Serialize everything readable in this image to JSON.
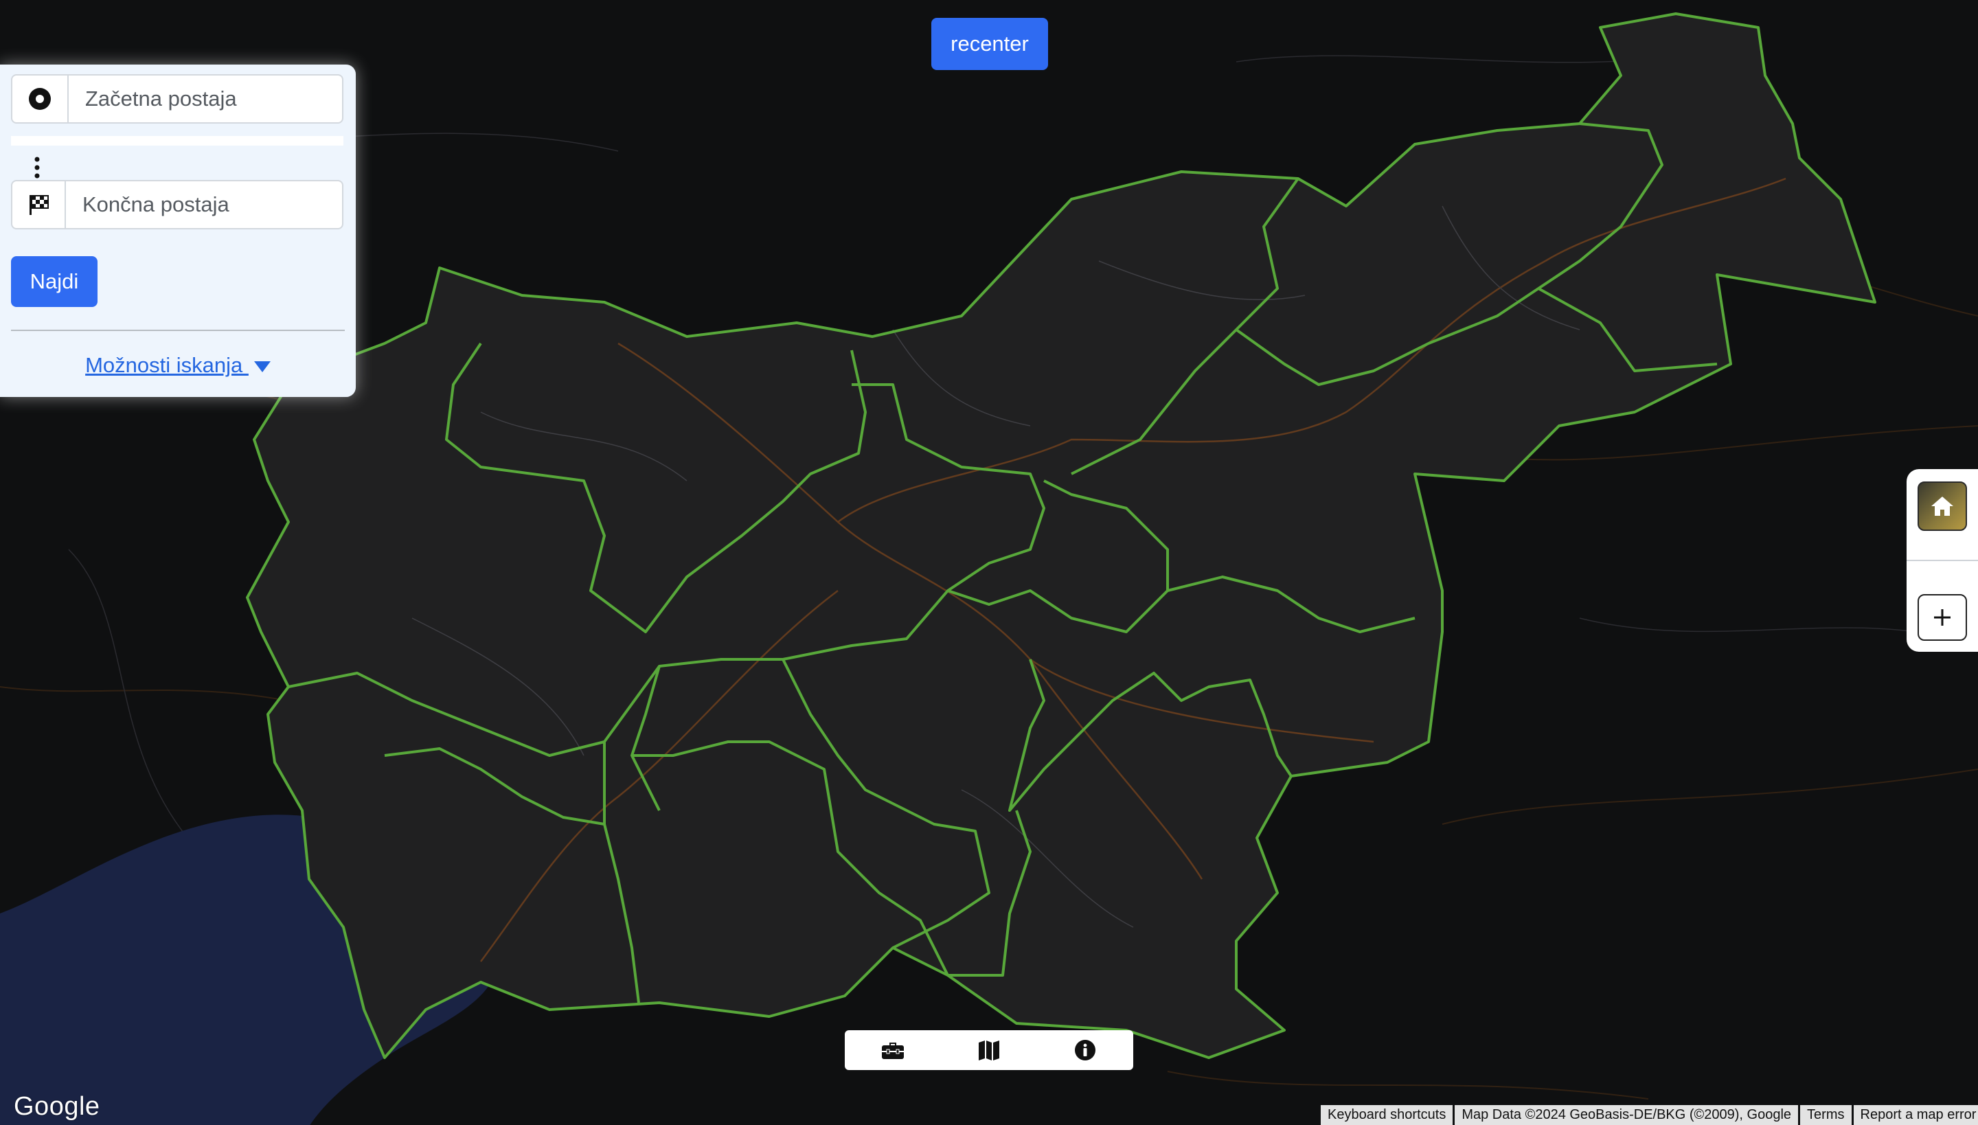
{
  "route_panel": {
    "start_placeholder": "Začetna postaja",
    "end_placeholder": "Končna postaja",
    "search_button": "Najdi",
    "options_link": "Možnosti iskanja "
  },
  "map": {
    "recenter_button": "recenter",
    "side_controls": [
      "home-icon",
      "plus-icon"
    ],
    "toolbar_icons": [
      "toolbox-icon",
      "map-icon",
      "info-icon"
    ],
    "logo_text": "Google",
    "attribution": {
      "shortcuts": "Keyboard shortcuts",
      "map_data": "Map Data ©2024 GeoBasis-DE/BKG (©2009), Google",
      "terms": "Terms",
      "report": "Report a map error"
    },
    "colors": {
      "land": "#202021",
      "background": "#0f1011",
      "region_border": "#58a83a",
      "sea": "#1a2344",
      "road": "#6a3e1e",
      "accent": "#2f6bf2"
    }
  }
}
